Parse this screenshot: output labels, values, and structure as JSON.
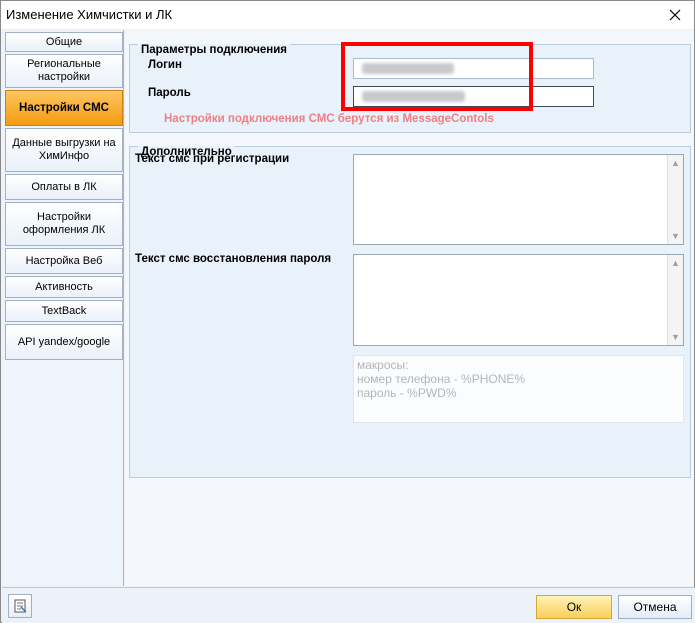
{
  "window": {
    "title": "Изменение Химчистки и ЛК"
  },
  "sidebar": {
    "items": [
      {
        "label": "Общие",
        "active": false
      },
      {
        "label": "Региональные настройки",
        "active": false
      },
      {
        "label": "Настройки СМС",
        "active": true
      },
      {
        "label": "Данные выгрузки на ХимИнфо",
        "active": false
      },
      {
        "label": "Оплаты в ЛК",
        "active": false
      },
      {
        "label": "Настройки оформления ЛК",
        "active": false
      },
      {
        "label": "Настройка Веб",
        "active": false
      },
      {
        "label": "Активность",
        "active": false
      },
      {
        "label": "TextBack",
        "active": false
      },
      {
        "label": "API yandex/google",
        "active": false
      }
    ]
  },
  "connection": {
    "title": "Параметры подключения",
    "login_label": "Логин",
    "password_label": "Пароль",
    "hint": "Настройки подключения СМС берутся из MessageContols"
  },
  "extra": {
    "title": "Дополнительно",
    "register_sms_label": "Текст смс при регистрации",
    "restore_sms_label": "Текст смс восстановления пароля",
    "register_sms_value": "",
    "restore_sms_value": "",
    "macros": [
      "макросы:",
      "номер телефона - %PHONE%",
      "пароль - %PWD%"
    ]
  },
  "footer": {
    "ok_label": "Ок",
    "cancel_label": "Отмена"
  },
  "colors": {
    "active_tab": "#f7a829",
    "highlight_border": "#ff0000",
    "hint_text": "#ee7f84"
  }
}
